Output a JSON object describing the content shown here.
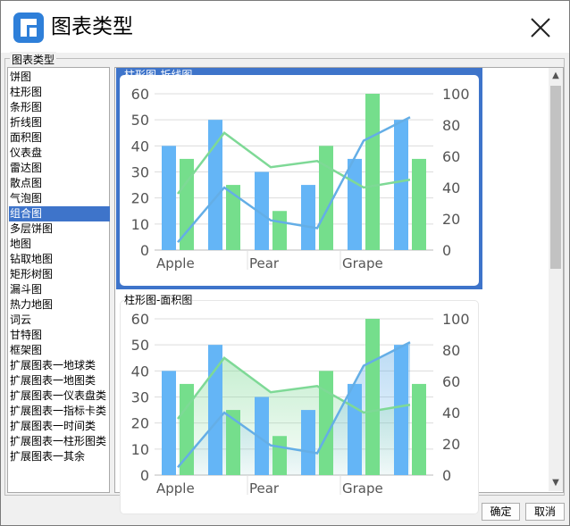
{
  "dialog": {
    "title": "图表类型"
  },
  "group_label": "图表类型",
  "chart_types": [
    "饼图",
    "柱形图",
    "条形图",
    "折线图",
    "面积图",
    "仪表盘",
    "雷达图",
    "散点图",
    "气泡图",
    "组合图",
    "多层饼图",
    "地图",
    "钻取地图",
    "矩形树图",
    "漏斗图",
    "热力地图",
    "词云",
    "甘特图",
    "框架图",
    "扩展图表一地球类",
    "扩展图表一地图类",
    "扩展图表一仪表盘类",
    "扩展图表一指标卡类",
    "扩展图表一时间类",
    "扩展图表一柱形图类",
    "扩展图表一其余"
  ],
  "selected_type": "组合图",
  "colors": {
    "selection": "#3e74ca",
    "bar_blue": "#64b5f6",
    "bar_green": "#75de8c",
    "line_blue": "#64aee6",
    "line_green": "#7ed996"
  },
  "buttons": {
    "ok": "确定",
    "cancel": "取消"
  },
  "chart_data": [
    {
      "type": "combo",
      "subtype": "柱形图-折线图",
      "title": "柱形图-折线图",
      "x_tick_labels": [
        "Apple",
        "Pear",
        "Grape"
      ],
      "left_axis": {
        "ticks": [
          0,
          10,
          20,
          30,
          40,
          50,
          60
        ],
        "ylim": [
          0,
          60
        ]
      },
      "right_axis": {
        "ticks": [
          0,
          20,
          40,
          60,
          80,
          100
        ],
        "ylim": [
          0,
          100
        ]
      },
      "grid": "horizontal",
      "bars_blue": [
        40,
        50,
        30,
        25,
        35,
        50
      ],
      "bars_green": [
        35,
        25,
        15,
        40,
        60,
        35
      ],
      "line_blue": [
        5,
        40,
        19,
        14,
        70,
        85
      ],
      "line_green": [
        36,
        75,
        53,
        57,
        40,
        45
      ]
    },
    {
      "type": "combo",
      "subtype": "柱形图-面积图",
      "title": "柱形图-面积图",
      "x_tick_labels": [
        "Apple",
        "Pear",
        "Grape"
      ],
      "left_axis": {
        "ticks": [
          0,
          10,
          20,
          30,
          40,
          50,
          60
        ],
        "ylim": [
          0,
          60
        ]
      },
      "right_axis": {
        "ticks": [
          0,
          20,
          40,
          60,
          80,
          100
        ],
        "ylim": [
          0,
          100
        ]
      },
      "grid": "horizontal",
      "bars_blue": [
        40,
        50,
        30,
        25,
        35,
        50
      ],
      "bars_green": [
        35,
        25,
        15,
        40,
        60,
        35
      ],
      "area_blue": [
        5,
        40,
        19,
        14,
        70,
        85
      ],
      "area_green": [
        36,
        75,
        53,
        57,
        40,
        45
      ]
    }
  ]
}
